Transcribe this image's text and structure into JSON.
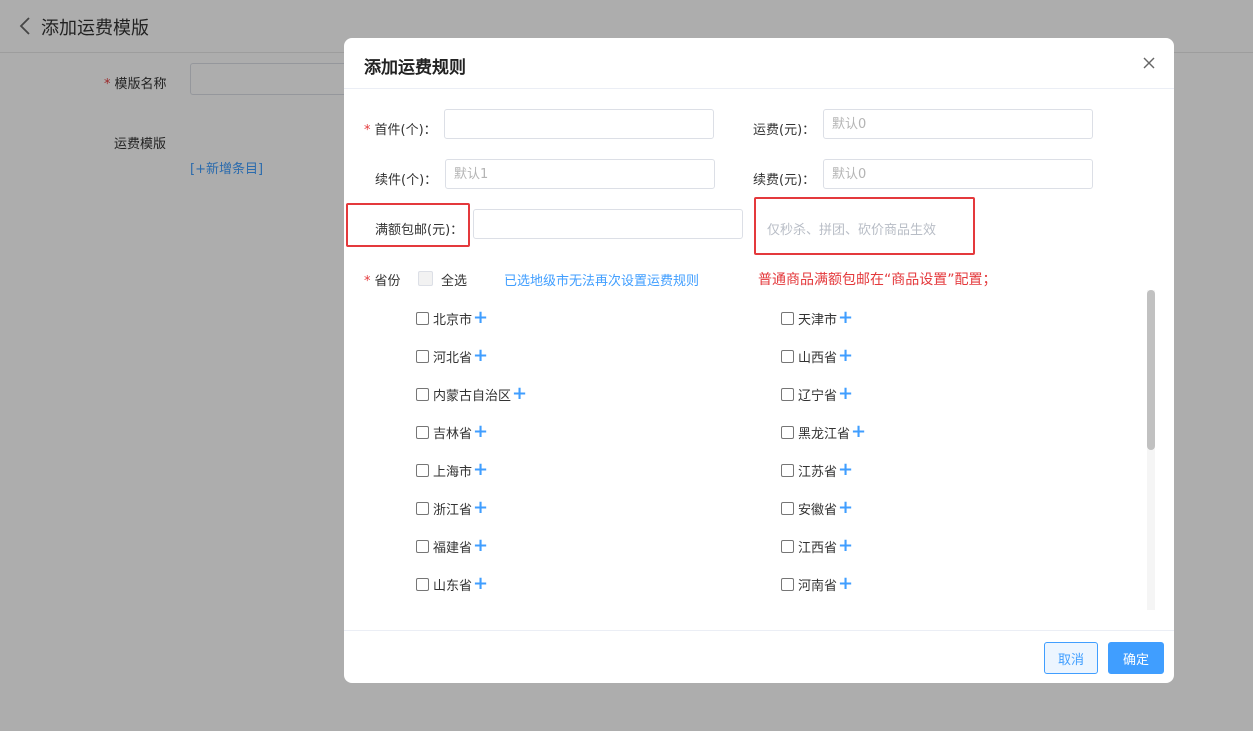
{
  "background": {
    "title": "添加运费模版",
    "template_name_label": "模版名称",
    "template_label": "运费模版",
    "add_item_link": "[+新增条目]"
  },
  "modal": {
    "title": "添加运费规则",
    "first_item": {
      "label": "首件(个)：",
      "value": "",
      "placeholder": ""
    },
    "first_fee": {
      "label": "运费(元)：",
      "value": "",
      "placeholder": "默认0"
    },
    "extra_item": {
      "label": "续件(个)：",
      "value": "",
      "placeholder": "默认1"
    },
    "extra_fee": {
      "label": "续费(元)：",
      "value": "",
      "placeholder": "默认0"
    },
    "free_shipping": {
      "label": "满额包邮(元)：",
      "value": "",
      "placeholder": ""
    },
    "free_shipping_hint": "仅秒杀、拼团、砍价商品生效",
    "province_label": "省份",
    "select_all_label": "全选",
    "city_notice": "已选地级市无法再次设置运费规则",
    "config_notice": "普通商品满额包邮在“商品设置”配置；",
    "provinces_left": [
      "北京市",
      "河北省",
      "内蒙古自治区",
      "吉林省",
      "上海市",
      "浙江省",
      "福建省",
      "山东省"
    ],
    "provinces_right": [
      "天津市",
      "山西省",
      "辽宁省",
      "黑龙江省",
      "江苏省",
      "安徽省",
      "江西省",
      "河南省"
    ],
    "cancel_label": "取消",
    "confirm_label": "确定"
  },
  "colors": {
    "primary": "#409eff",
    "required_star": "#e4393c",
    "highlight_box": "#e4393c"
  }
}
